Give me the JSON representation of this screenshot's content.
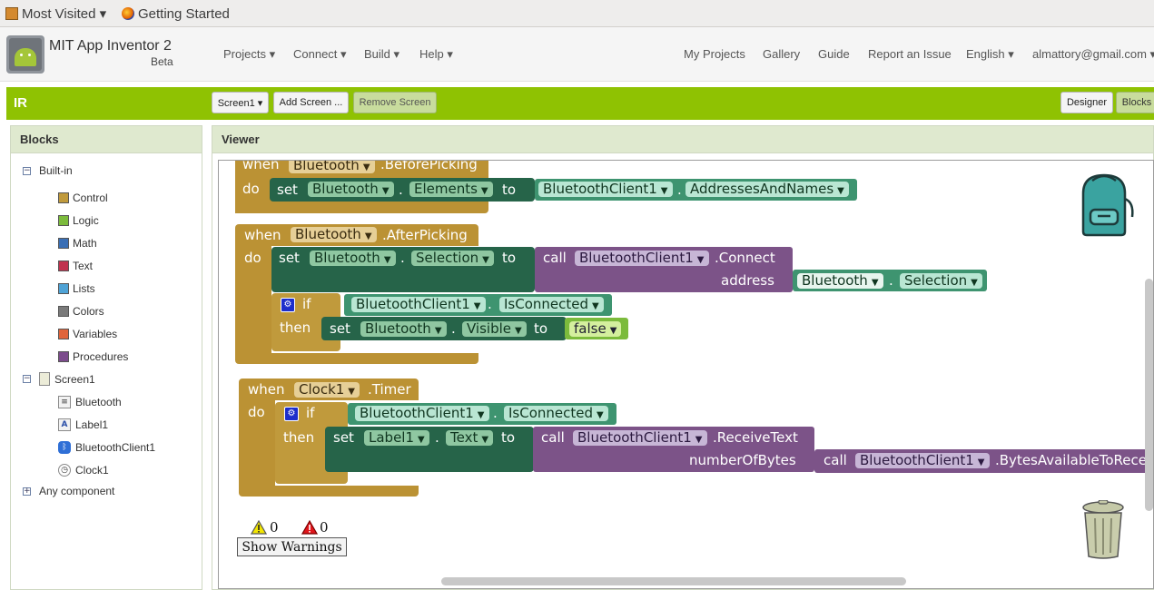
{
  "bookmarks": [
    {
      "label": "Most Visited ▾"
    },
    {
      "label": "Getting Started"
    }
  ],
  "header": {
    "title": "MIT App Inventor 2",
    "beta": "Beta",
    "menus": [
      "Projects ▾",
      "Connect ▾",
      "Build ▾",
      "Help ▾"
    ],
    "right_links": [
      "My Projects",
      "Gallery",
      "Guide",
      "Report an Issue",
      "English ▾",
      "almattory@gmail.com ▾"
    ]
  },
  "toolbar": {
    "project": "IR",
    "screen_select": "Screen1 ▾",
    "add_screen": "Add Screen ...",
    "remove_screen": "Remove Screen",
    "designer": "Designer",
    "blocks": "Blocks"
  },
  "blocks_panel": {
    "title": "Blocks",
    "builtin": "Built-in",
    "categories": [
      {
        "label": "Control",
        "color": "#c09a3c"
      },
      {
        "label": "Logic",
        "color": "#7cbb3c"
      },
      {
        "label": "Math",
        "color": "#3a6fb5"
      },
      {
        "label": "Text",
        "color": "#c0334f"
      },
      {
        "label": "Lists",
        "color": "#4fa3d6"
      },
      {
        "label": "Colors",
        "color": "#7a7a7a"
      },
      {
        "label": "Variables",
        "color": "#e0643a"
      },
      {
        "label": "Procedures",
        "color": "#7c4c8c"
      }
    ],
    "screen": "Screen1",
    "components": [
      {
        "label": "Bluetooth",
        "icon": "listpicker-icon"
      },
      {
        "label": "Label1",
        "icon": "label-icon"
      },
      {
        "label": "BluetoothClient1",
        "icon": "bluetooth-icon"
      },
      {
        "label": "Clock1",
        "icon": "clock-icon"
      }
    ],
    "any_component": "Any component"
  },
  "viewer": {
    "title": "Viewer",
    "warnings": "0",
    "errors": "0",
    "show_warnings": "Show Warnings"
  },
  "blocks": {
    "b1": {
      "when": "when",
      "comp": "Bluetooth",
      "event": ".BeforePicking",
      "do": "do",
      "set": "set",
      "set_comp": "Bluetooth",
      "dot": ".",
      "prop": "Elements",
      "to": "to",
      "get_comp": "BluetoothClient1",
      "get_prop": "AddressesAndNames"
    },
    "b2": {
      "when": "when",
      "comp": "Bluetooth",
      "event": ".AfterPicking",
      "do": "do",
      "set": "set",
      "set_comp": "Bluetooth",
      "dot": ".",
      "prop": "Selection",
      "to": "to",
      "call": "call",
      "call_comp": "BluetoothClient1",
      "method": ".Connect",
      "arg": "address",
      "arg_comp": "Bluetooth",
      "arg_prop": "Selection",
      "if": "if",
      "if_comp": "BluetoothClient1",
      "if_prop": "IsConnected",
      "then": "then",
      "set2": "set",
      "set2_comp": "Bluetooth",
      "set2_prop": "Visible",
      "to2": "to",
      "false": "false"
    },
    "b3": {
      "when": "when",
      "comp": "Clock1",
      "event": ".Timer",
      "do": "do",
      "if": "if",
      "if_comp": "BluetoothClient1",
      "if_prop": "IsConnected",
      "then": "then",
      "set": "set",
      "set_comp": "Label1",
      "dot": ".",
      "prop": "Text",
      "to": "to",
      "call": "call",
      "call_comp": "BluetoothClient1",
      "method": ".ReceiveText",
      "arg": "numberOfBytes",
      "call2": "call",
      "call2_comp": "BluetoothClient1",
      "method2": ".BytesAvailableToRece"
    }
  },
  "colors": {
    "event_block": "#bb9234",
    "setter_block": "#266449",
    "getter_block": "#3e9470",
    "call_block": "#7c5388",
    "logic_block": "#7cbb3c",
    "toolbar_green": "#8fc202"
  }
}
